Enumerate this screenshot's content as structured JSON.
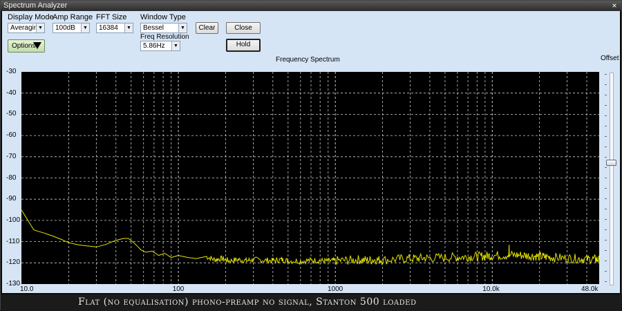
{
  "window": {
    "title": "Spectrum Analyzer",
    "close_glyph": "×"
  },
  "controls": {
    "display_mode": {
      "label": "Display Mode",
      "value": "Averaging"
    },
    "amp_range": {
      "label": "Amp Range",
      "value": "100dB"
    },
    "fft_size": {
      "label": "FFT Size",
      "value": "16384"
    },
    "window_type": {
      "label": "Window Type",
      "value": "Bessel"
    },
    "freq_resolution": {
      "label": "Freq Resolution",
      "value": "5.86Hz"
    },
    "clear_label": "Clear",
    "close_label": "Close",
    "hold_label": "Hold",
    "options_label": "Options"
  },
  "offset_label": "Offset",
  "offset_slider_position": 0.43,
  "caption": "Flat (no equalisation) phono-preamp no signal, Stanton 500 loaded",
  "chart_data": {
    "type": "line",
    "title": "Frequency Spectrum",
    "x_scale": "log",
    "xlim": [
      10,
      48000
    ],
    "ylim": [
      -130,
      -30
    ],
    "y_ticks": [
      -30,
      -40,
      -50,
      -60,
      -70,
      -80,
      -90,
      -100,
      -110,
      -120,
      -130
    ],
    "x_tick_labels": [
      {
        "value": 10,
        "label": "10.0"
      },
      {
        "value": 100,
        "label": "100"
      },
      {
        "value": 1000,
        "label": "1000"
      },
      {
        "value": 10000,
        "label": "10.0k"
      },
      {
        "value": 48000,
        "label": "48.0k"
      }
    ],
    "grid": true,
    "background": "#000000",
    "trace_color": "#e6e600",
    "series": [
      {
        "x": [
          10,
          11,
          12,
          14,
          16,
          18,
          20,
          23,
          26,
          30,
          34,
          38,
          42,
          45,
          48,
          52,
          58,
          62,
          68,
          75,
          82,
          90,
          100,
          115,
          130,
          150,
          170,
          190,
          210,
          240,
          270,
          300,
          350,
          400,
          450,
          500,
          600,
          700,
          800,
          900,
          1000,
          1200,
          1400,
          1600,
          1800,
          2000,
          2500,
          3000,
          3500,
          4000,
          5000,
          6000,
          7000,
          8000,
          9000,
          10000,
          12000,
          14000,
          16000,
          18000,
          20000,
          22000,
          25000,
          30000,
          35000,
          40000,
          45000,
          48000
        ],
        "y": [
          -95,
          -100,
          -104.5,
          -106,
          -107.5,
          -109,
          -110.5,
          -111.5,
          -112,
          -112.5,
          -111.5,
          -110,
          -109,
          -108.5,
          -108.5,
          -110.5,
          -114,
          -115,
          -114.5,
          -116.5,
          -115.5,
          -117.5,
          -116.5,
          -117.5,
          -118,
          -117,
          -118.5,
          -118,
          -119,
          -118.5,
          -119,
          -118.5,
          -118.8,
          -119,
          -118.5,
          -119,
          -119.2,
          -118.8,
          -119,
          -119.2,
          -119,
          -118.8,
          -118.5,
          -118.8,
          -118.5,
          -118.7,
          -118.2,
          -118,
          -117.8,
          -117.7,
          -117.5,
          -117.3,
          -117.2,
          -117,
          -116.8,
          -116.6,
          -116.4,
          -116.3,
          -116.5,
          -116.8,
          -117,
          -117.2,
          -117.5,
          -117.8,
          -118,
          -118.2,
          -118.3,
          -118.5
        ]
      }
    ],
    "spur": {
      "x": 12800,
      "y": -111.5
    }
  }
}
